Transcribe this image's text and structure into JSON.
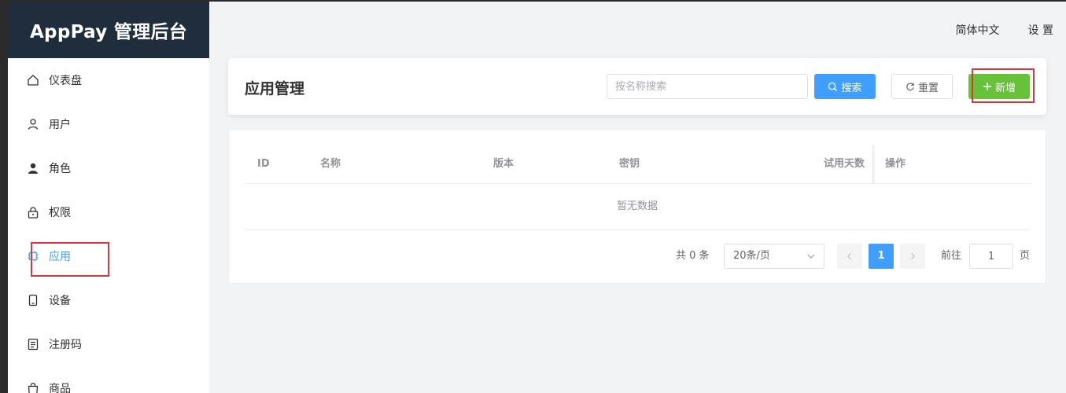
{
  "app": {
    "title": "AppPay 管理后台"
  },
  "sidebar": {
    "items": [
      {
        "label": "仪表盘",
        "icon": "home-icon"
      },
      {
        "label": "用户",
        "icon": "user-icon"
      },
      {
        "label": "角色",
        "icon": "role-icon"
      },
      {
        "label": "权限",
        "icon": "lock-icon"
      },
      {
        "label": "应用",
        "icon": "chip-icon",
        "active": true
      },
      {
        "label": "设备",
        "icon": "phone-icon"
      },
      {
        "label": "注册码",
        "icon": "document-icon"
      },
      {
        "label": "商品",
        "icon": "bag-icon"
      }
    ]
  },
  "topbar": {
    "language": "简体中文",
    "settings": "设 置"
  },
  "header": {
    "title": "应用管理",
    "search_placeholder": "按名称搜索",
    "search_button": "搜索",
    "reset_button": "重置",
    "add_button": "新增"
  },
  "table": {
    "columns": [
      "ID",
      "名称",
      "版本",
      "密钥",
      "试用天数",
      "操作"
    ],
    "rows": [],
    "empty_text": "暂无数据"
  },
  "pagination": {
    "total_text": "共 0 条",
    "page_size": "20条/页",
    "current_page": "1",
    "goto_label": "前往",
    "goto_value": "1",
    "page_unit": "页"
  },
  "colors": {
    "sidebar_header_bg": "#1f2d3d",
    "primary": "#409eff",
    "success": "#67c23a",
    "highlight_border": "#d9363e"
  }
}
